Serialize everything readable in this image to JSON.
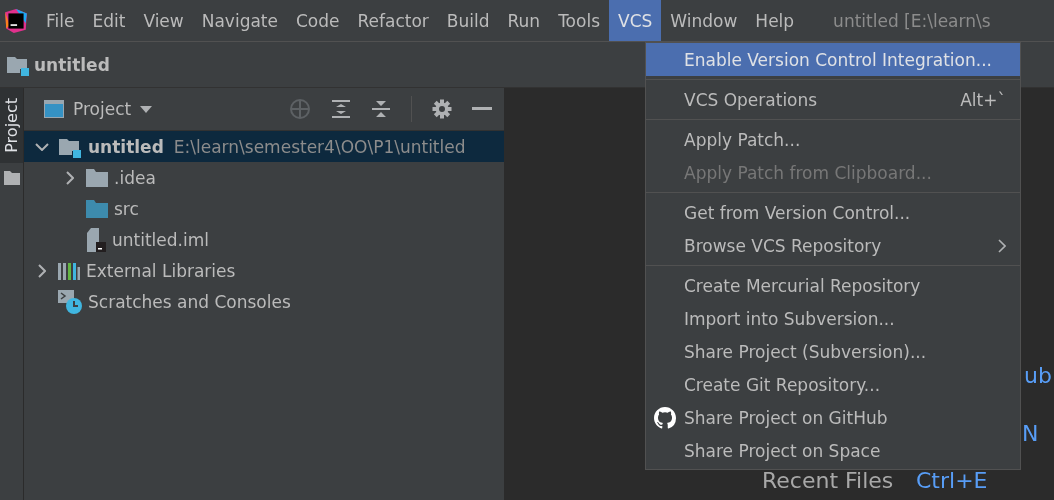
{
  "menubar": {
    "items": [
      {
        "label": "File",
        "selected": false
      },
      {
        "label": "Edit",
        "selected": false
      },
      {
        "label": "View",
        "selected": false
      },
      {
        "label": "Navigate",
        "selected": false
      },
      {
        "label": "Code",
        "selected": false
      },
      {
        "label": "Refactor",
        "selected": false
      },
      {
        "label": "Build",
        "selected": false
      },
      {
        "label": "Run",
        "selected": false
      },
      {
        "label": "Tools",
        "selected": false
      },
      {
        "label": "VCS",
        "selected": true
      },
      {
        "label": "Window",
        "selected": false
      },
      {
        "label": "Help",
        "selected": false
      }
    ],
    "window_title": "untitled [E:\\learn\\s"
  },
  "breadcrumb": {
    "label": "untitled"
  },
  "side_strip": {
    "tab": {
      "label": "Project",
      "selected": true
    }
  },
  "project_panel": {
    "view_selector": "Project",
    "tree": [
      {
        "label": "untitled",
        "path": "E:\\learn\\semester4\\OO\\P1\\untitled",
        "kind": "module",
        "expanded": true,
        "selected": true,
        "children": [
          {
            "label": ".idea",
            "kind": "folder",
            "expanded": false,
            "selected": false
          },
          {
            "label": "src",
            "kind": "source-folder",
            "selected": false
          },
          {
            "label": "untitled.iml",
            "kind": "iml",
            "selected": false
          }
        ]
      },
      {
        "label": "External Libraries",
        "kind": "libraries",
        "expanded": false,
        "selected": false
      },
      {
        "label": "Scratches and Consoles",
        "kind": "scratches",
        "selected": false
      }
    ]
  },
  "editor_hints": [
    {
      "text": "ub",
      "kind": "shortcut"
    },
    {
      "text": "N",
      "kind": "shortcut"
    },
    {
      "text": "Recent Files",
      "kind": "action"
    },
    {
      "text": "Ctrl+E",
      "kind": "shortcut"
    }
  ],
  "vcs_menu": [
    {
      "kind": "item",
      "label": "Enable Version Control Integration...",
      "selected": true,
      "disabled": false
    },
    {
      "kind": "separator"
    },
    {
      "kind": "item",
      "label": "VCS Operations",
      "shortcut": "Alt+`",
      "selected": false,
      "disabled": false
    },
    {
      "kind": "separator"
    },
    {
      "kind": "item",
      "label": "Apply Patch...",
      "selected": false,
      "disabled": false
    },
    {
      "kind": "item",
      "label": "Apply Patch from Clipboard...",
      "selected": false,
      "disabled": true
    },
    {
      "kind": "separator"
    },
    {
      "kind": "item",
      "label": "Get from Version Control...",
      "selected": false,
      "disabled": false
    },
    {
      "kind": "item",
      "label": "Browse VCS Repository",
      "submenu": true,
      "selected": false,
      "disabled": false
    },
    {
      "kind": "separator"
    },
    {
      "kind": "item",
      "label": "Create Mercurial Repository",
      "selected": false,
      "disabled": false
    },
    {
      "kind": "item",
      "label": "Import into Subversion...",
      "selected": false,
      "disabled": false
    },
    {
      "kind": "item",
      "label": "Share Project (Subversion)...",
      "selected": false,
      "disabled": false
    },
    {
      "kind": "item",
      "label": "Create Git Repository...",
      "selected": false,
      "disabled": false
    },
    {
      "kind": "github-item",
      "label": "Share Project on GitHub",
      "selected": false,
      "disabled": false
    },
    {
      "kind": "item",
      "label": "Share Project on Space",
      "selected": false,
      "disabled": false
    }
  ]
}
